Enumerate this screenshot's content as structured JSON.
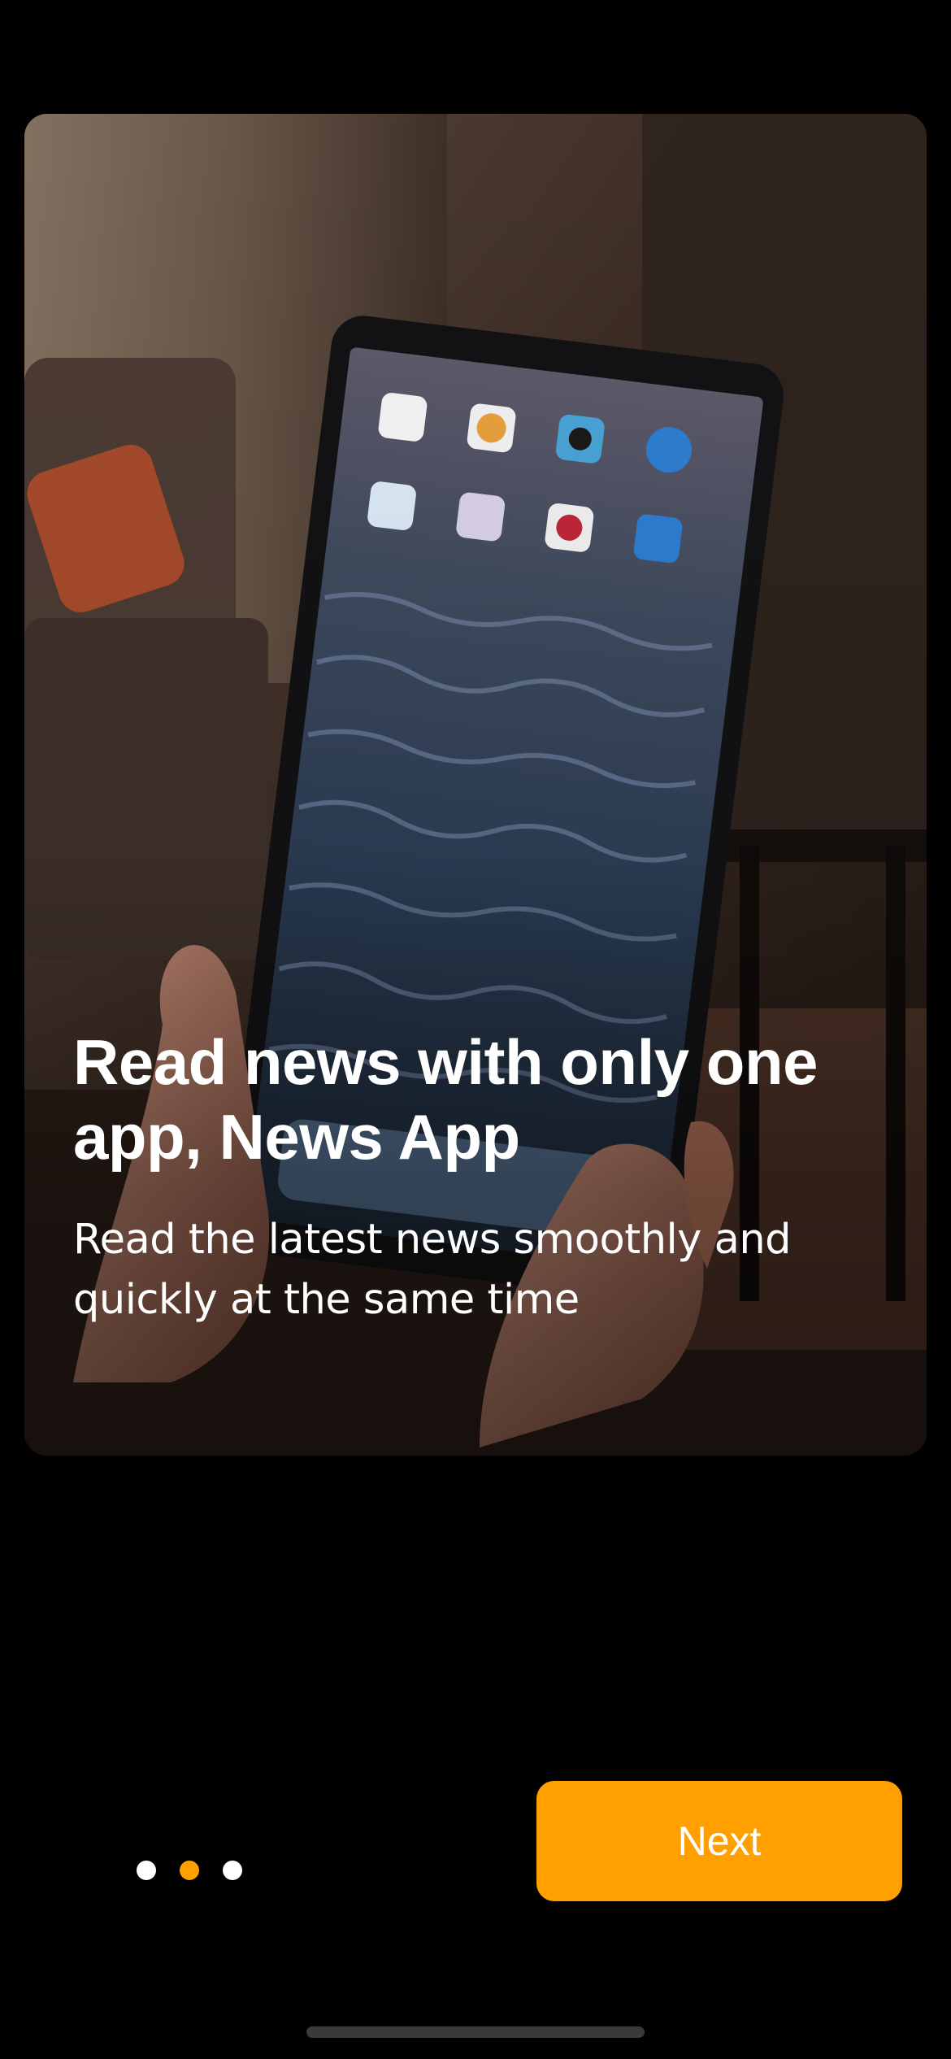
{
  "onboarding": {
    "headline": "Read news with only one app, News App",
    "subtitle": "Read the latest news smoothly and quickly at the same time",
    "hero_image": "hands-holding-tablet-photo",
    "pager": {
      "count": 3,
      "active_index": 1
    },
    "next_label": "Next"
  },
  "colors": {
    "background": "#000000",
    "accent": "#FFA000",
    "text": "#FFFFFF",
    "dot_inactive": "#FFFFFF",
    "dot_active": "#FFA000",
    "home_indicator": "#3A3A3C"
  }
}
